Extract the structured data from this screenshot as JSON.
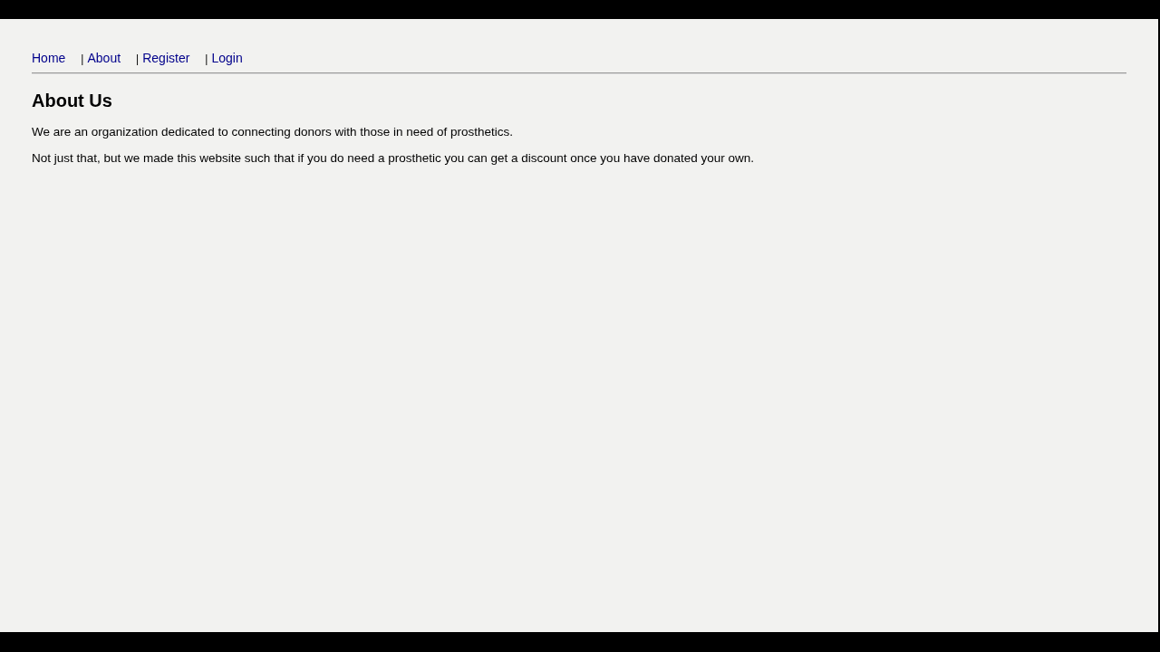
{
  "nav": [
    {
      "label": "Home"
    },
    {
      "separator": "|",
      "label": "About"
    },
    {
      "separator": "|",
      "label": "Register"
    },
    {
      "separator": "|",
      "label": "Login"
    }
  ],
  "heading": "About Us",
  "paragraphs": [
    "We are an organization dedicated to connecting donors with those in need of prosthetics.",
    "Not just that, but we made this website such that if you do need a prosthetic you can get a discount once you have donated your own."
  ]
}
